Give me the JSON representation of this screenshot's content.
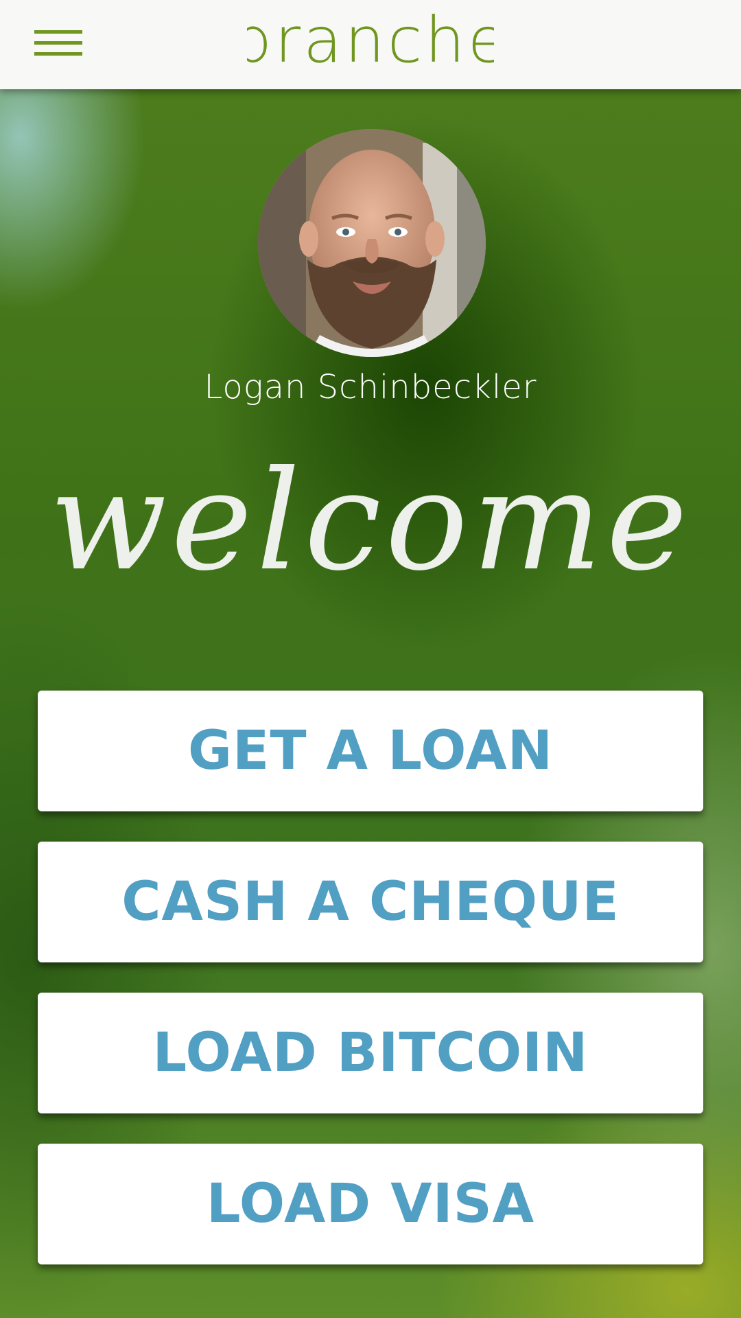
{
  "header": {
    "brand": "branche",
    "menu_icon": "hamburger-menu-icon",
    "brand_color": "#6f961f"
  },
  "profile": {
    "name": "Logan Schinbeckler"
  },
  "welcome_text": "welcome",
  "actions": [
    {
      "label": "GET A LOAN"
    },
    {
      "label": "CASH A CHEQUE"
    },
    {
      "label": "LOAD BITCOIN"
    },
    {
      "label": "LOAD VISA"
    }
  ],
  "colors": {
    "button_text": "#529fc4",
    "button_bg": "#ffffff"
  }
}
